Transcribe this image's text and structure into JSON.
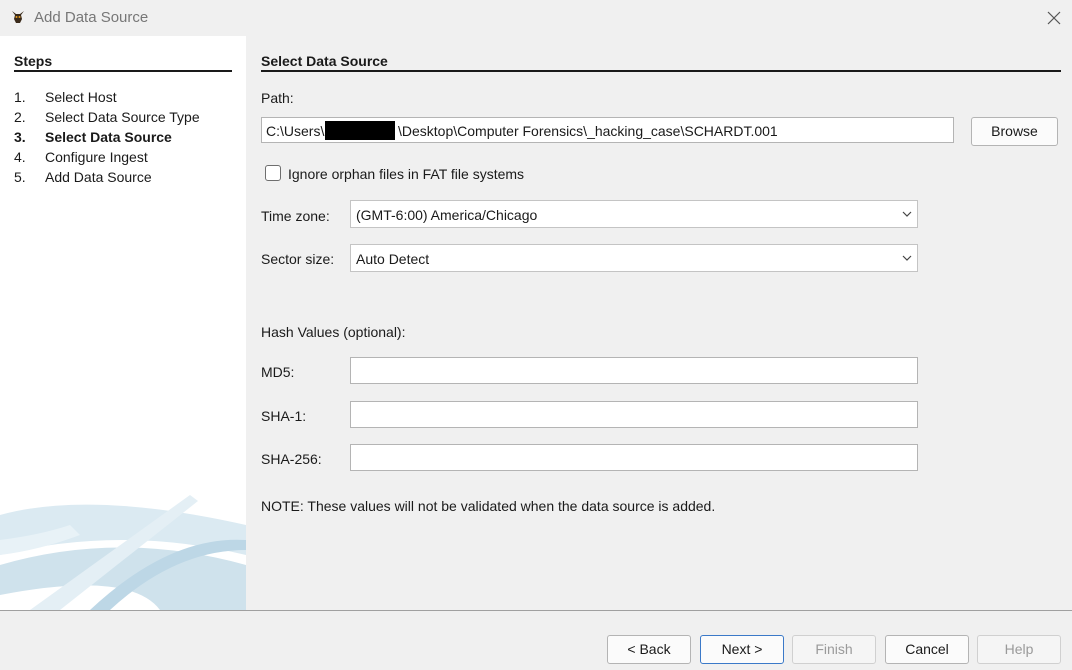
{
  "window": {
    "title": "Add Data Source",
    "app_icon": "autopsy-dog-icon",
    "close_icon": "close-icon"
  },
  "steps": {
    "header": "Steps",
    "items": [
      {
        "num": "1.",
        "label": "Select Host",
        "active": false
      },
      {
        "num": "2.",
        "label": "Select Data Source Type",
        "active": false
      },
      {
        "num": "3.",
        "label": "Select Data Source",
        "active": true
      },
      {
        "num": "4.",
        "label": "Configure Ingest",
        "active": false
      },
      {
        "num": "5.",
        "label": "Add Data Source",
        "active": false
      }
    ]
  },
  "form": {
    "section_title": "Select Data Source",
    "path_label": "Path:",
    "path_prefix": "C:\\Users\\",
    "path_suffix": "\\Desktop\\Computer Forensics\\_hacking_case\\SCHARDT.001",
    "browse_label": "Browse",
    "ignore_orphan_label": "Ignore orphan files in FAT file systems",
    "ignore_orphan_checked": false,
    "timezone_label": "Time zone:",
    "timezone_value": "(GMT-6:00) America/Chicago",
    "sector_label": "Sector size:",
    "sector_value": "Auto Detect",
    "hash_header": "Hash Values (optional):",
    "md5_label": "MD5:",
    "sha1_label": "SHA-1:",
    "sha256_label": "SHA-256:",
    "md5_value": "",
    "sha1_value": "",
    "sha256_value": "",
    "note": "NOTE: These values will not be validated when the data source is added."
  },
  "buttons": {
    "back": "< Back",
    "next": "Next >",
    "finish": "Finish",
    "cancel": "Cancel",
    "help": "Help"
  },
  "colors": {
    "accent": "#3b79c8",
    "panel": "#ffffff",
    "background": "#f0f0f0"
  }
}
